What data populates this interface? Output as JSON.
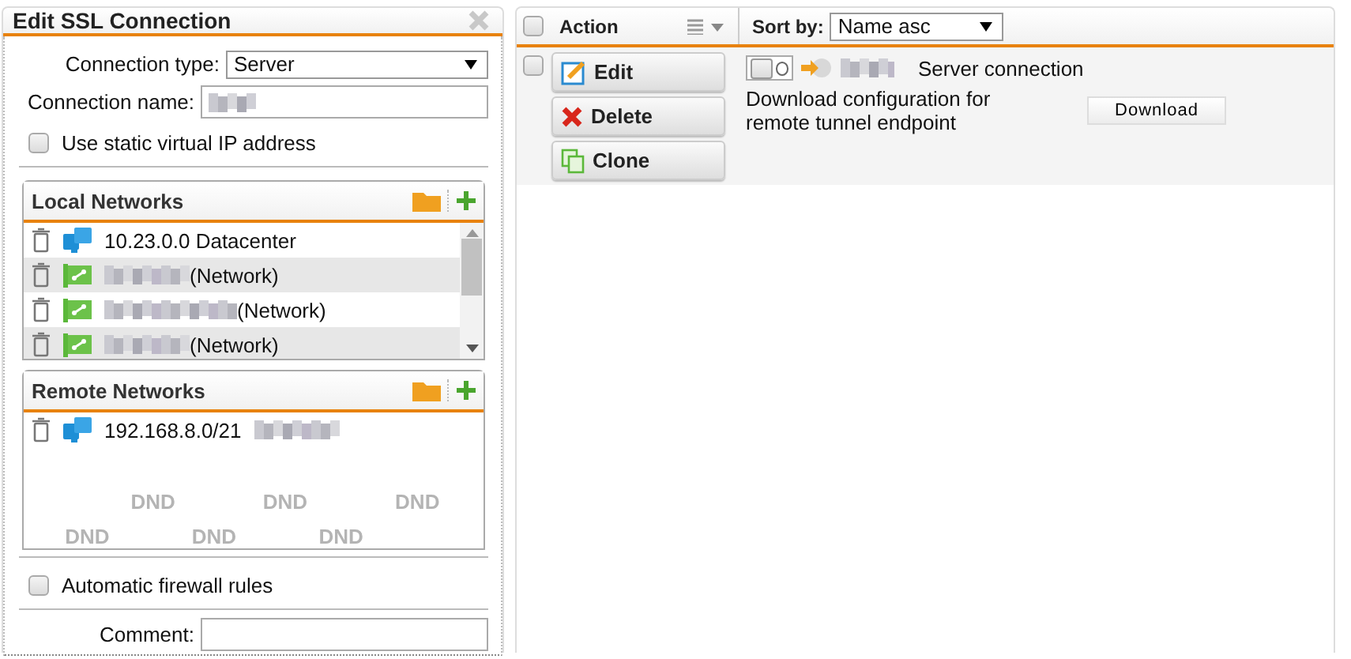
{
  "dialog": {
    "title": "Edit SSL Connection",
    "connection_type": {
      "label": "Connection type:",
      "value": "Server"
    },
    "connection_name": {
      "label": "Connection name:",
      "masked": true
    },
    "static_ip": {
      "label": "Use static virtual IP address",
      "checked": false
    },
    "local_networks": {
      "title": "Local Networks",
      "items": [
        {
          "kind": "host",
          "text": "10.23.0.0 Datacenter"
        },
        {
          "kind": "network",
          "masked_before": true,
          "text": "(Network)"
        },
        {
          "kind": "network",
          "masked_before": true,
          "text": "(Network)"
        },
        {
          "kind": "network",
          "masked_before": true,
          "text": "(Network)"
        }
      ]
    },
    "remote_networks": {
      "title": "Remote Networks",
      "items": [
        {
          "kind": "host",
          "masked_after": true,
          "text": "192.168.8.0/21"
        }
      ],
      "drop_hints": [
        [
          "DND",
          "DND",
          "DND"
        ],
        [
          "DND",
          "DND",
          "DND"
        ]
      ]
    },
    "auto_firewall": {
      "label": "Automatic firewall rules",
      "checked": false
    },
    "comment": {
      "label": "Comment:"
    }
  },
  "list": {
    "select_all": false,
    "action_label": "Action",
    "sort_label": "Sort by:",
    "sort_value": "Name asc",
    "rows": [
      {
        "checked": false,
        "enabled": false,
        "masked_name": true,
        "type": "Server connection",
        "actions": [
          {
            "kind": "edit",
            "label": "Edit"
          },
          {
            "kind": "delete",
            "label": "Delete"
          },
          {
            "kind": "clone",
            "label": "Clone"
          }
        ],
        "download_text": "Download configuration for remote tunnel endpoint",
        "download_button": "Download"
      }
    ]
  }
}
